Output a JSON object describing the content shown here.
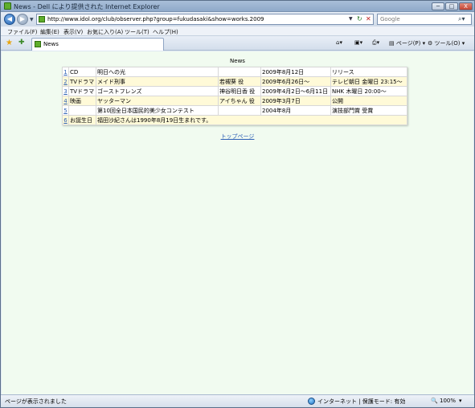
{
  "window": {
    "title": "News - Dell により提供された Internet Explorer",
    "min_label": "─",
    "max_label": "□",
    "close_label": "X"
  },
  "address": {
    "url": "http://www.idol.org/club/observer.php?group=fukudasaki&show=works.2009",
    "search_placeholder": "Google"
  },
  "menu": [
    "ファイル(F)",
    "編集(E)",
    "表示(V)",
    "お気に入り(A)",
    "ツール(T)",
    "ヘルプ(H)"
  ],
  "tab": {
    "label": "News"
  },
  "toolbar": {
    "page_label": "ページ(P)",
    "tools_label": "ツール(O)"
  },
  "page": {
    "heading": "News",
    "rows": [
      {
        "num": "1",
        "category": "CD",
        "title": "明日への光",
        "role": "",
        "date": "2009年8月12日",
        "note": "リリース"
      },
      {
        "num": "2",
        "category": "TVドラマ",
        "title": "メイド刑事",
        "role": "若槻葵 役",
        "date": "2009年6月26日～",
        "note": "テレビ朝日 金曜日 23:15～"
      },
      {
        "num": "3",
        "category": "TVドラマ",
        "title": "ゴーストフレンズ",
        "role": "神谷明日香 役",
        "date": "2009年4月2日～6月11日",
        "note": "NHK 木曜日 20:00～"
      },
      {
        "num": "4",
        "category": "映画",
        "title": "ヤッターマン",
        "role": "アイちゃん 役",
        "date": "2009年3月7日",
        "note": "公開"
      },
      {
        "num": "5",
        "category": "",
        "title": "第10回全日本国民的美少女コンテスト",
        "role": "",
        "date": "2004年8月",
        "note": "演技部門賞 受賞"
      },
      {
        "num": "6",
        "category": "お誕生日",
        "title": "福田沙紀さんは1990年8月19日生まれです。",
        "role": "",
        "date": "",
        "note": ""
      }
    ],
    "top_link": "トップページ"
  },
  "status": {
    "left": "ページが表示されました",
    "zone": "インターネット | 保護モード: 有効",
    "zoom": "100%"
  }
}
